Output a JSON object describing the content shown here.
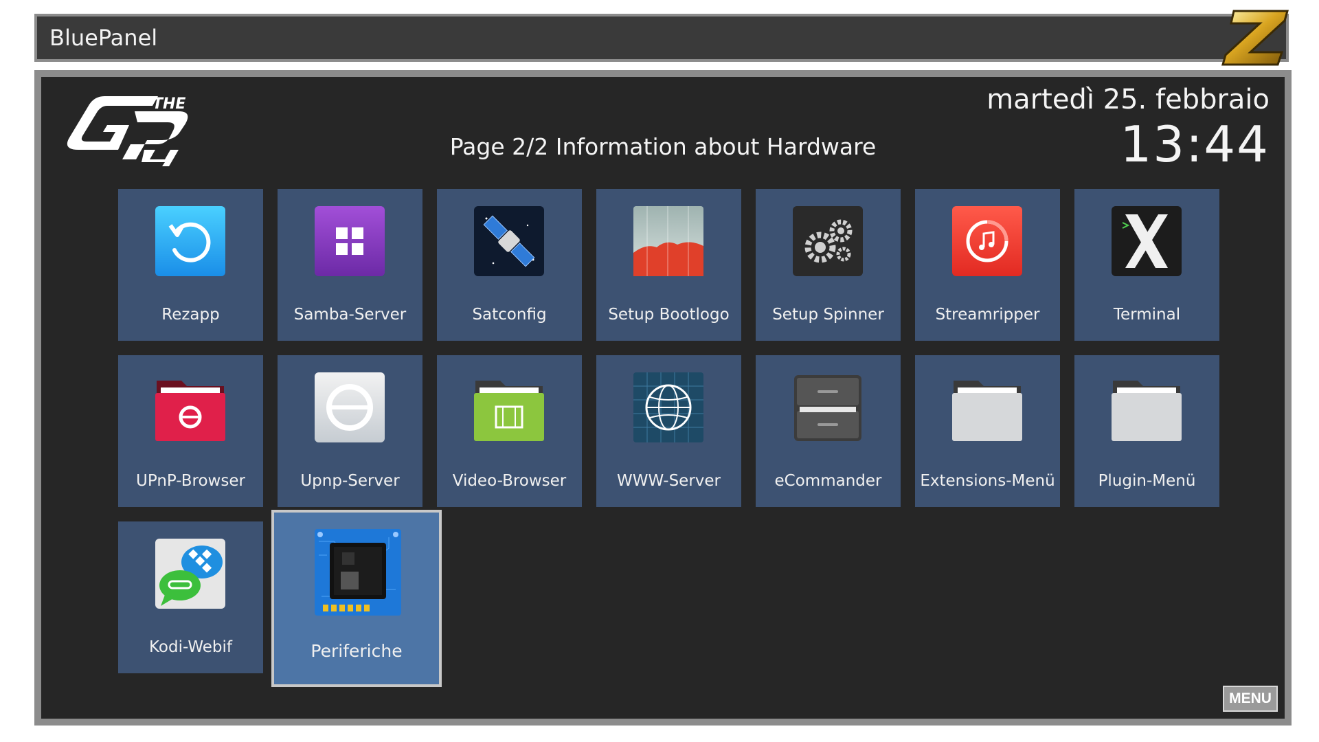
{
  "window": {
    "title": "BluePanel"
  },
  "header": {
    "date": "martedì 25. febbraio",
    "time": "13:44",
    "page_title": "Page 2/2 Information about Hardware"
  },
  "tiles": [
    {
      "label": "Rezapp",
      "icon": "refresh-icon"
    },
    {
      "label": "Samba-Server",
      "icon": "grid-icon"
    },
    {
      "label": "Satconfig",
      "icon": "satellite-icon"
    },
    {
      "label": "Setup Bootlogo",
      "icon": "bootlogo-icon"
    },
    {
      "label": "Setup Spinner",
      "icon": "gears-icon"
    },
    {
      "label": "Streamripper",
      "icon": "music-icon"
    },
    {
      "label": "Terminal",
      "icon": "terminal-x-icon"
    },
    {
      "label": "UPnP-Browser",
      "icon": "upnp-folder-icon"
    },
    {
      "label": "Upnp-Server",
      "icon": "upnp-server-icon"
    },
    {
      "label": "Video-Browser",
      "icon": "video-folder-icon"
    },
    {
      "label": "WWW-Server",
      "icon": "globe-icon"
    },
    {
      "label": "eCommander",
      "icon": "drawer-icon"
    },
    {
      "label": "Extensions-Menü",
      "icon": "folder-icon"
    },
    {
      "label": "Plugin-Menü",
      "icon": "folder-icon"
    },
    {
      "label": "Kodi-Webif",
      "icon": "kodi-chat-icon"
    },
    {
      "label": "Periferiche",
      "icon": "chip-icon",
      "selected": true
    }
  ],
  "menu_button": "MENU",
  "colors": {
    "tile": "#3d5272",
    "tile_selected": "#4d75a6",
    "panel": "#262626",
    "frame": "#8c8c8c"
  }
}
